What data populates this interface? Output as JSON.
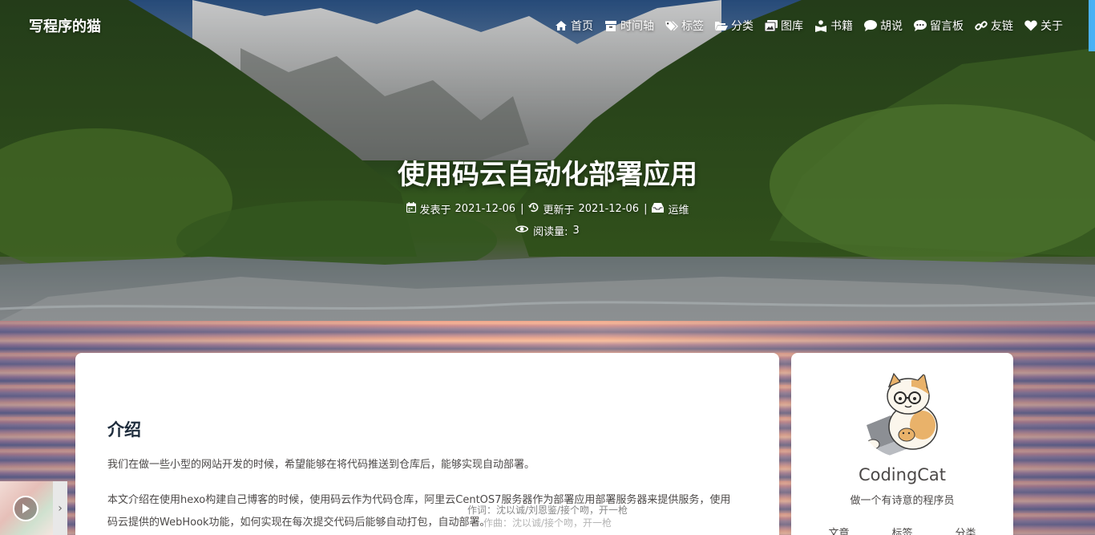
{
  "site": {
    "brand": "写程序的猫"
  },
  "nav": [
    {
      "label": "首页",
      "icon": "home-icon"
    },
    {
      "label": "时间轴",
      "icon": "archive-icon"
    },
    {
      "label": "标签",
      "icon": "tags-icon"
    },
    {
      "label": "分类",
      "icon": "folder-open-icon"
    },
    {
      "label": "图库",
      "icon": "images-icon"
    },
    {
      "label": "书籍",
      "icon": "book-reader-icon"
    },
    {
      "label": "胡说",
      "icon": "comment-icon"
    },
    {
      "label": "留言板",
      "icon": "comment-dots-icon"
    },
    {
      "label": "友链",
      "icon": "link-icon"
    },
    {
      "label": "关于",
      "icon": "heart-icon"
    }
  ],
  "post": {
    "title": "使用码云自动化部署应用",
    "published_label": "发表于",
    "published": "2021-12-06",
    "updated_label": "更新于",
    "updated": "2021-12-06",
    "separator": "|",
    "category": "运维",
    "views_label": "阅读量:",
    "views": "3"
  },
  "article": {
    "heading": "介绍",
    "p1": "我们在做一些小型的网站开发的时候，希望能够在将代码推送到仓库后，能够实现自动部署。",
    "p2": "本文介绍在使用hexo构建自己博客的时候，使用码云作为代码仓库，阿里云CentOS7服务器作为部署应用部署服务器来提供服务，使用码云提供的WebHook功能，如何实现在每次提交代码后能够自动打包，自动部署。"
  },
  "author": {
    "name": "CodingCat",
    "description": "做一个有诗意的程序员",
    "stats": [
      {
        "label": "文章"
      },
      {
        "label": "标签"
      },
      {
        "label": "分类"
      }
    ]
  },
  "player": {
    "lyric_line1": "作词：沈以诚/刘恩鉴/接个吻，开一枪",
    "lyric_line2": "作曲：沈以诚/接个吻，开一枪",
    "toggle_symbol": "›"
  },
  "colors": {
    "accent": "#49b1f5",
    "heading": "#1f2d3d",
    "text": "#4c4948"
  }
}
